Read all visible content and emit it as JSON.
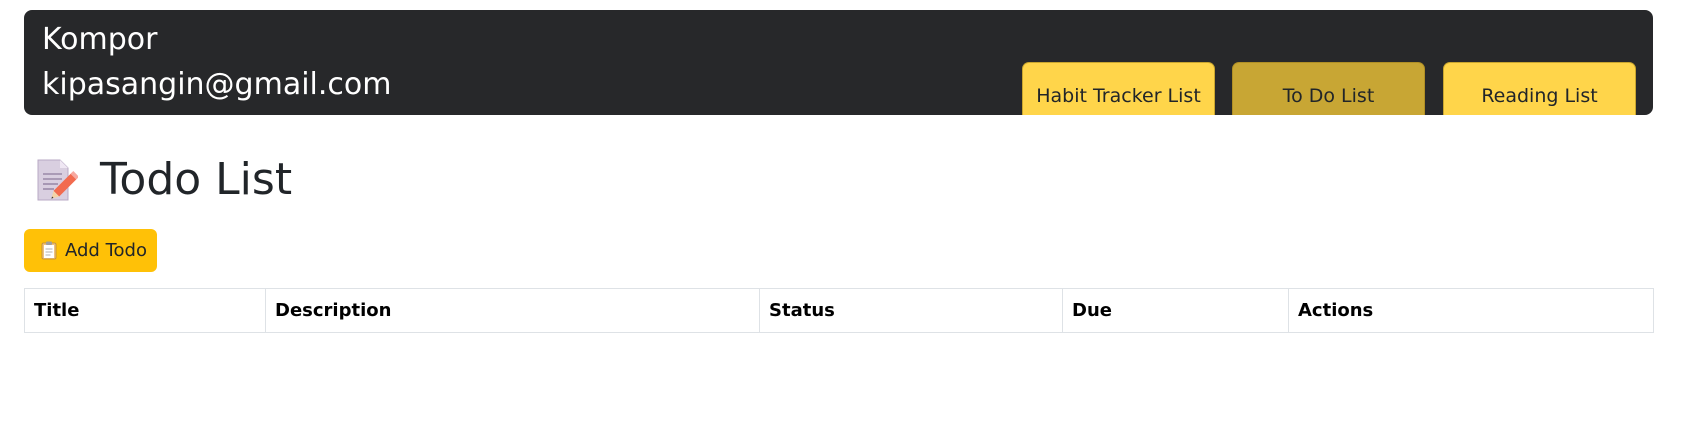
{
  "header": {
    "user_name": "Kompor",
    "user_email": "kipasangin@gmail.com",
    "tabs": [
      {
        "label": "Habit Tracker List",
        "active": false
      },
      {
        "label": "To Do List",
        "active": true
      },
      {
        "label": "Reading List",
        "active": false
      }
    ]
  },
  "main": {
    "title": "Todo List",
    "title_icon": "memo-icon",
    "add_button": {
      "label": "Add Todo",
      "icon": "clipboard-icon"
    },
    "table": {
      "columns": [
        "Title",
        "Description",
        "Status",
        "Due",
        "Actions"
      ],
      "rows": []
    }
  },
  "colors": {
    "header_bg": "#27282a",
    "tab_bg": "#ffd54a",
    "tab_active_bg": "#c8a634",
    "add_button_bg": "#ffc107"
  }
}
